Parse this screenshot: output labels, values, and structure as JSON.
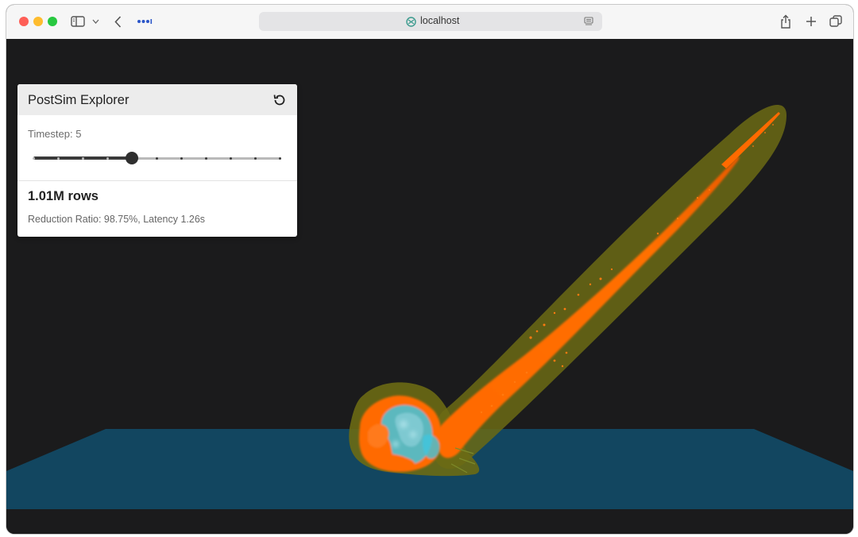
{
  "browser": {
    "url": "localhost",
    "icons": {
      "sidebar": "sidebar-icon",
      "sidebar_menu": "chevron-down-icon",
      "back": "chevron-left-icon",
      "extension": "dots-icon",
      "site": "site-globe-icon",
      "reader": "reader-icon",
      "share": "share-icon",
      "new_tab": "plus-icon",
      "tabs": "tabs-overview-icon"
    }
  },
  "panel": {
    "title": "PostSim Explorer",
    "reset_icon": "reset-icon",
    "timestep_label": "Timestep: 5",
    "slider": {
      "min": 1,
      "max": 11,
      "value": 5,
      "steps": 11
    },
    "rows": "1.01M rows",
    "stats": "Reduction Ratio: 98.75%, Latency 1.26s"
  },
  "scene": {
    "background": "#1b1b1c",
    "ground_color": "#124660",
    "plume_envelope_color": "#6b6a14",
    "plume_core_color": "#ff6a00",
    "crater_color": "#3ec6df"
  }
}
